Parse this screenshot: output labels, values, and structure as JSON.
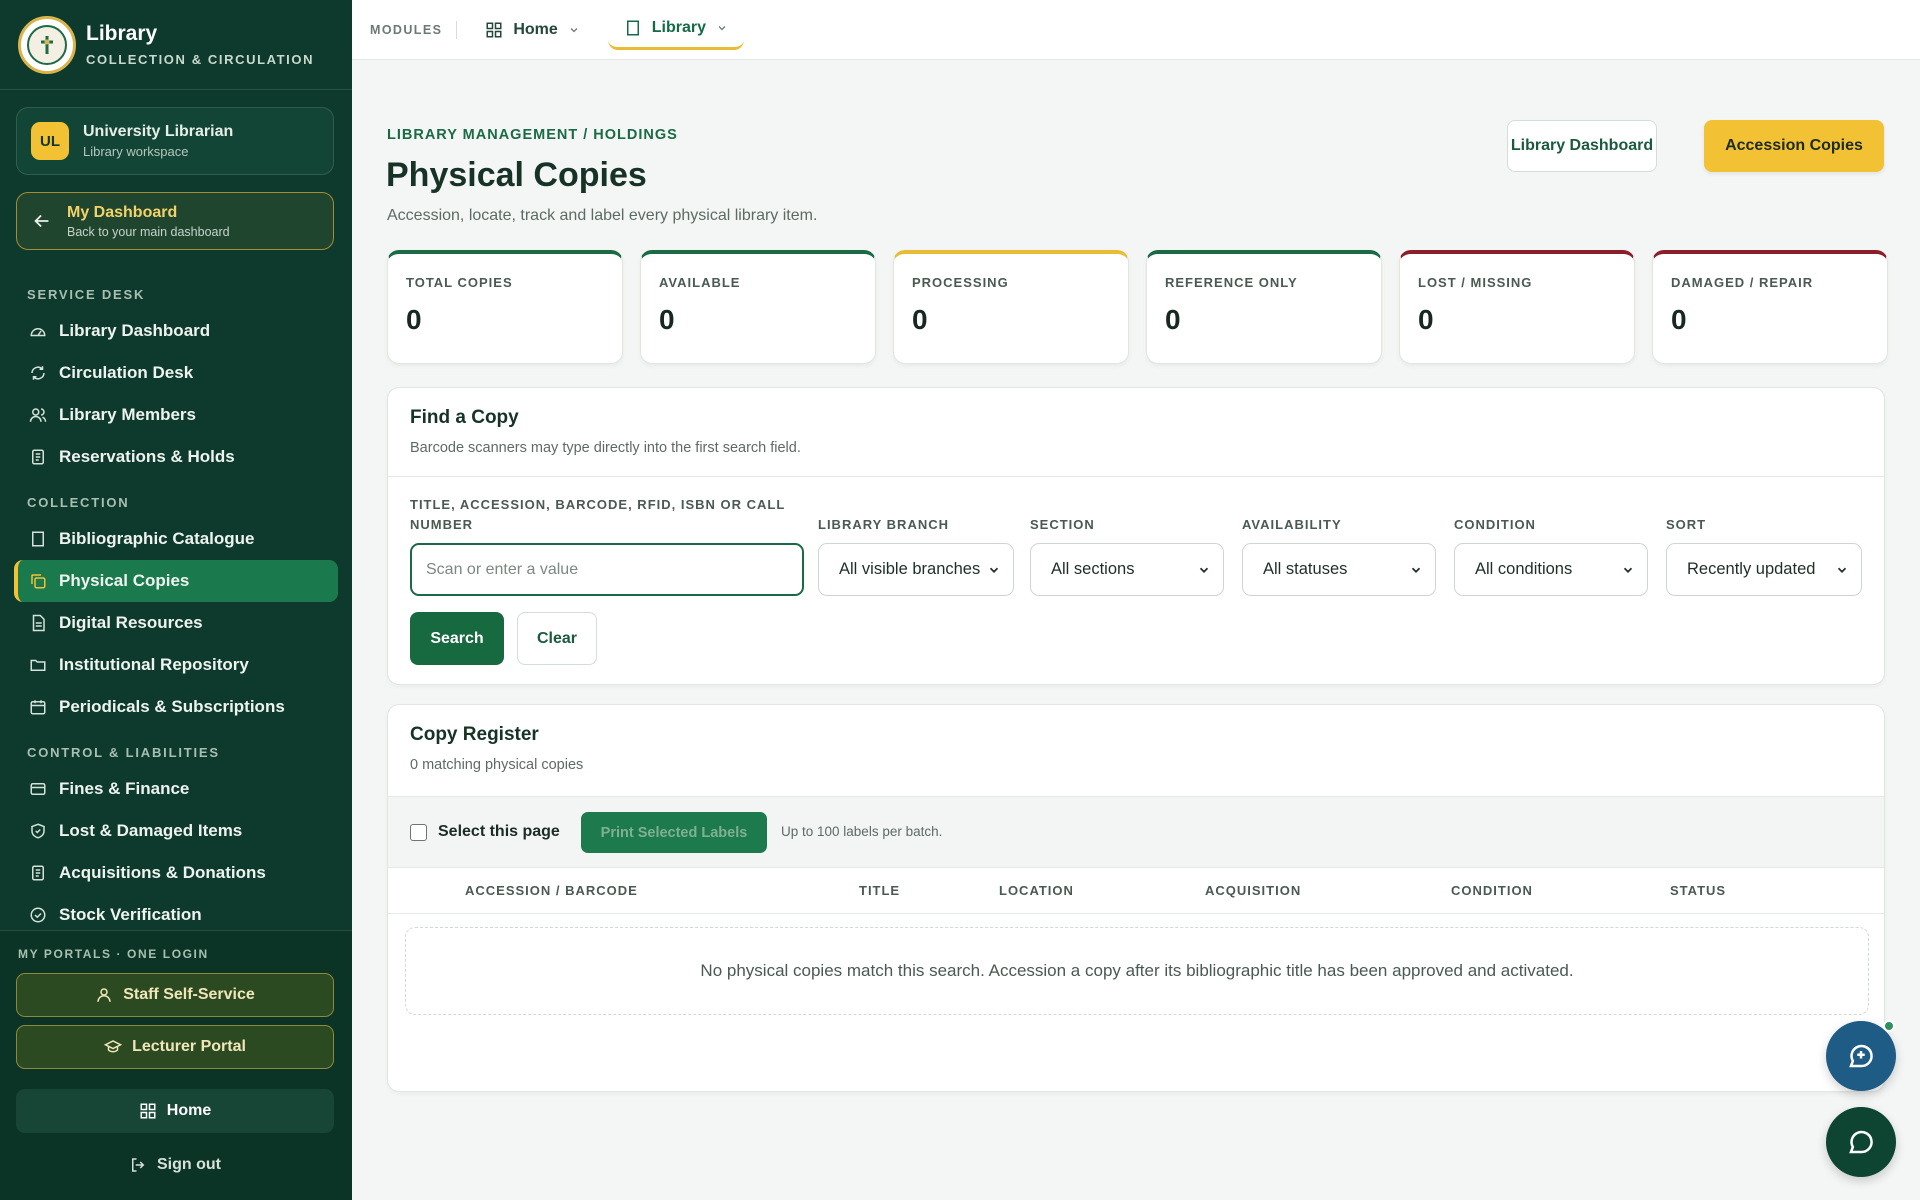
{
  "brand": {
    "title": "Library",
    "subtitle": "COLLECTION & CIRCULATION"
  },
  "user": {
    "initials": "UL",
    "name": "University Librarian",
    "role": "Library workspace"
  },
  "dashboard_link": {
    "title": "My Dashboard",
    "subtitle": "Back to your main dashboard"
  },
  "nav": {
    "service_desk": {
      "label": "SERVICE DESK",
      "items": [
        {
          "label": "Library Dashboard",
          "icon": "gauge-icon"
        },
        {
          "label": "Circulation Desk",
          "icon": "refresh-icon"
        },
        {
          "label": "Library Members",
          "icon": "users-icon"
        },
        {
          "label": "Reservations & Holds",
          "icon": "clipboard-icon"
        }
      ]
    },
    "collection": {
      "label": "COLLECTION",
      "items": [
        {
          "label": "Bibliographic Catalogue",
          "icon": "book-icon"
        },
        {
          "label": "Physical Copies",
          "icon": "copies-icon",
          "active": true
        },
        {
          "label": "Digital Resources",
          "icon": "file-icon"
        },
        {
          "label": "Institutional Repository",
          "icon": "folder-icon"
        },
        {
          "label": "Periodicals & Subscriptions",
          "icon": "calendar-icon"
        }
      ]
    },
    "control": {
      "label": "CONTROL & LIABILITIES",
      "items": [
        {
          "label": "Fines & Finance",
          "icon": "card-icon"
        },
        {
          "label": "Lost & Damaged Items",
          "icon": "shield-icon"
        },
        {
          "label": "Acquisitions & Donations",
          "icon": "clipboard-icon"
        },
        {
          "label": "Stock Verification",
          "icon": "check-circle-icon"
        }
      ]
    }
  },
  "portals": {
    "label": "MY PORTALS · ONE LOGIN",
    "staff": "Staff Self-Service",
    "lecturer": "Lecturer Portal",
    "home": "Home",
    "signout": "Sign out"
  },
  "topbar": {
    "modules_label": "MODULES",
    "home_tab": "Home",
    "library_tab": "Library"
  },
  "header": {
    "breadcrumb": "LIBRARY MANAGEMENT / HOLDINGS",
    "title": "Physical Copies",
    "subtitle": "Accession, locate, track and label every physical library item.",
    "btn_dashboard": "Library Dashboard",
    "btn_accession": "Accession Copies"
  },
  "stats": [
    {
      "label": "TOTAL COPIES",
      "value": "0",
      "color": "#196a45"
    },
    {
      "label": "AVAILABLE",
      "value": "0",
      "color": "#196a45"
    },
    {
      "label": "PROCESSING",
      "value": "0",
      "color": "#e8bd35"
    },
    {
      "label": "REFERENCE ONLY",
      "value": "0",
      "color": "#196a45"
    },
    {
      "label": "LOST / MISSING",
      "value": "0",
      "color": "#8a1f2b"
    },
    {
      "label": "DAMAGED / REPAIR",
      "value": "0",
      "color": "#8a1f2b"
    }
  ],
  "find": {
    "title": "Find a Copy",
    "subtitle": "Barcode scanners may type directly into the first search field.",
    "query_label": "TITLE, ACCESSION, BARCODE, RFID, ISBN OR CALL NUMBER",
    "query_placeholder": "Scan or enter a value",
    "branch_label": "LIBRARY BRANCH",
    "branch_value": "All visible branches",
    "section_label": "SECTION",
    "section_value": "All sections",
    "availability_label": "AVAILABILITY",
    "availability_value": "All statuses",
    "condition_label": "CONDITION",
    "condition_value": "All conditions",
    "sort_label": "SORT",
    "sort_value": "Recently updated",
    "search_btn": "Search",
    "clear_btn": "Clear"
  },
  "register": {
    "title": "Copy Register",
    "subtitle": "0 matching physical copies",
    "select_page": "Select this page",
    "print_btn": "Print Selected Labels",
    "print_hint": "Up to 100 labels per batch.",
    "columns": [
      "ACCESSION / BARCODE",
      "TITLE",
      "LOCATION",
      "ACQUISITION",
      "CONDITION",
      "STATUS"
    ],
    "empty_message": "No physical copies match this search. Accession a copy after its bibliographic title has been approved and activated."
  }
}
